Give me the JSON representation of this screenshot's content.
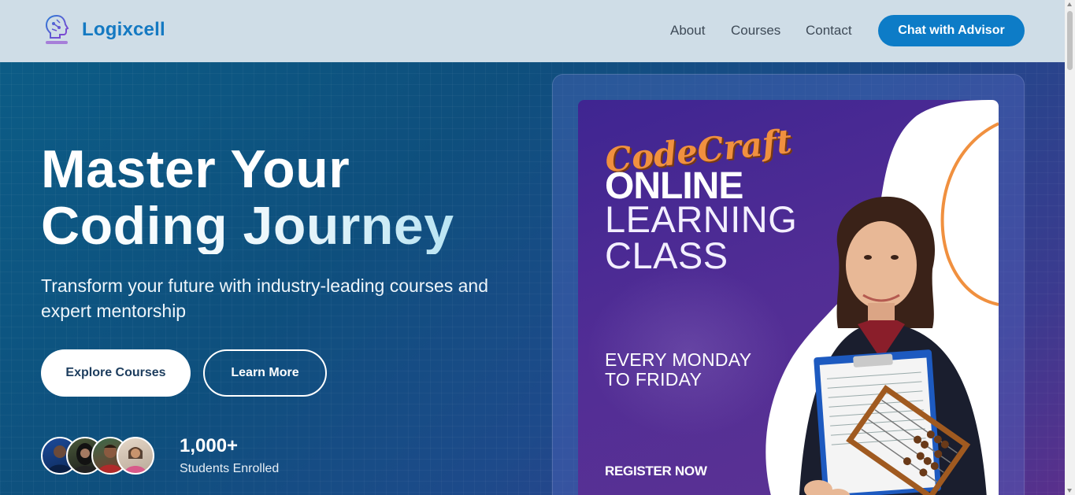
{
  "header": {
    "brand": "Logixcell",
    "nav": [
      "About",
      "Courses",
      "Contact"
    ],
    "cta_label": "Chat with Advisor"
  },
  "hero": {
    "title_line1": "Master Your",
    "title_line2": "Coding Journey",
    "subtitle": "Transform your future with industry-leading courses and expert mentorship",
    "primary_button": "Explore Courses",
    "secondary_button": "Learn More",
    "stat_number": "1,000+",
    "stat_label": "Students Enrolled"
  },
  "poster": {
    "script_title": "CodeCraft",
    "online": "ONLINE",
    "learning": "LEARNING",
    "class": "CLASS",
    "schedule_line1": "EVERY MONDAY",
    "schedule_line2": "TO FRIDAY",
    "register": "REGISTER NOW"
  },
  "colors": {
    "brand": "#1479c2",
    "cta": "#0d7cc7",
    "hero_start": "#0c5c86",
    "hero_end": "#5a2f8c",
    "poster_purple": "#4a2a8c",
    "poster_accent": "#f0903f"
  },
  "icons": [
    "brain-circuit-logo-icon",
    "scroll-up-arrow-icon",
    "scroll-down-arrow-icon"
  ]
}
